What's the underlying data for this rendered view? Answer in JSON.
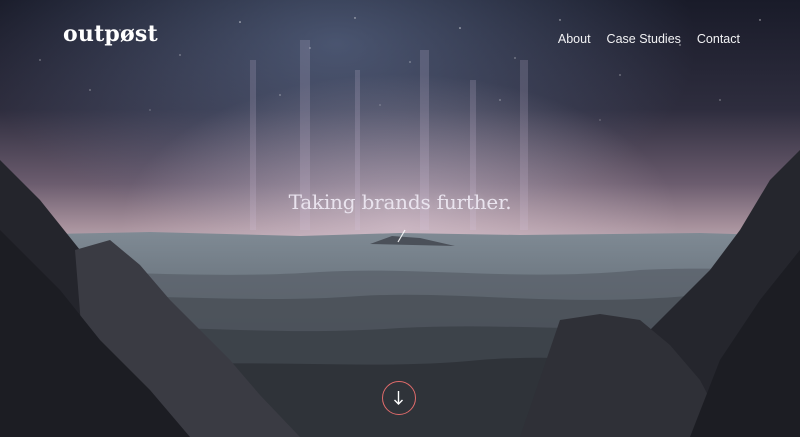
{
  "header": {
    "logo": "outpøst",
    "nav": [
      {
        "label": "About"
      },
      {
        "label": "Case Studies"
      },
      {
        "label": "Contact"
      }
    ]
  },
  "hero": {
    "tagline": "Taking brands further.",
    "scroll_icon": "arrow-down-icon"
  },
  "colors": {
    "accent": "#e06b6b",
    "text": "#ffffff"
  }
}
